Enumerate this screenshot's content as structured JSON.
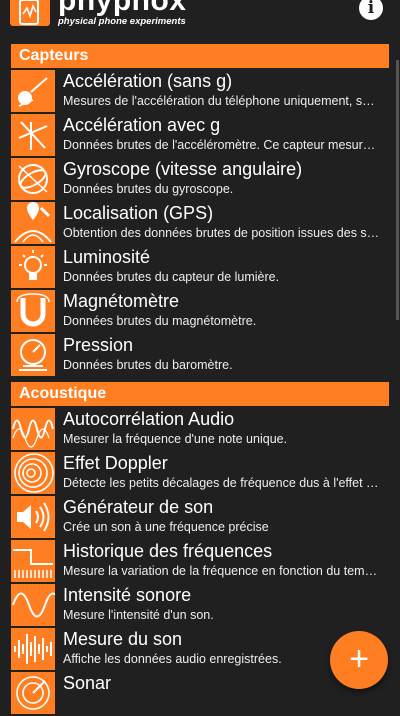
{
  "app": {
    "name": "phyphox",
    "tagline": "physical phone experiments",
    "info_icon": "i",
    "fab_icon": "+"
  },
  "colors": {
    "accent": "#ff7e22",
    "background": "#202020"
  },
  "sections": [
    {
      "title": "Capteurs",
      "items": [
        {
          "title": "Accélération (sans g)",
          "desc": "Mesures de l'accélération du téléphone uniquement, sans la gravité.",
          "icon": "acceleration-icon"
        },
        {
          "title": "Accélération avec g",
          "desc": "Données brutes de l'accéléromètre. Ce capteur mesure aussi la gravité.",
          "icon": "accelerometer-icon"
        },
        {
          "title": "Gyroscope (vitesse angulaire)",
          "desc": "Données brutes du gyroscope.",
          "icon": "gyroscope-icon"
        },
        {
          "title": "Localisation (GPS)",
          "desc": "Obtention des données brutes de position issues des satellites.",
          "icon": "location-icon"
        },
        {
          "title": "Luminosité",
          "desc": "Données brutes du capteur de lumière.",
          "icon": "light-bulb-icon"
        },
        {
          "title": "Magnétomètre",
          "desc": "Données brutes du magnétomètre.",
          "icon": "magnet-icon"
        },
        {
          "title": "Pression",
          "desc": "Données brutes du baromètre.",
          "icon": "pressure-gauge-icon"
        }
      ]
    },
    {
      "title": "Acoustique",
      "items": [
        {
          "title": "Autocorrélation Audio",
          "desc": "Mesurer la fréquence d'une note unique.",
          "icon": "waveform-icon"
        },
        {
          "title": "Effet Doppler",
          "desc": "Détecte les petits décalages de fréquence dus à l'effet Doppler.",
          "icon": "concentric-waves-icon"
        },
        {
          "title": "Générateur de son",
          "desc": "Crée un son à une fréquence précise",
          "icon": "speaker-icon"
        },
        {
          "title": "Historique des fréquences",
          "desc": "Mesure la variation de la fréquence en fonction du temps.",
          "icon": "frequency-history-icon"
        },
        {
          "title": "Intensité sonore",
          "desc": "Mesure l'intensité d'un son.",
          "icon": "sine-wave-icon"
        },
        {
          "title": "Mesure du son",
          "desc": "Affiche les données audio enregistrées.",
          "icon": "audio-signal-icon"
        },
        {
          "title": "Sonar",
          "desc": "",
          "icon": "sonar-icon"
        }
      ]
    }
  ]
}
